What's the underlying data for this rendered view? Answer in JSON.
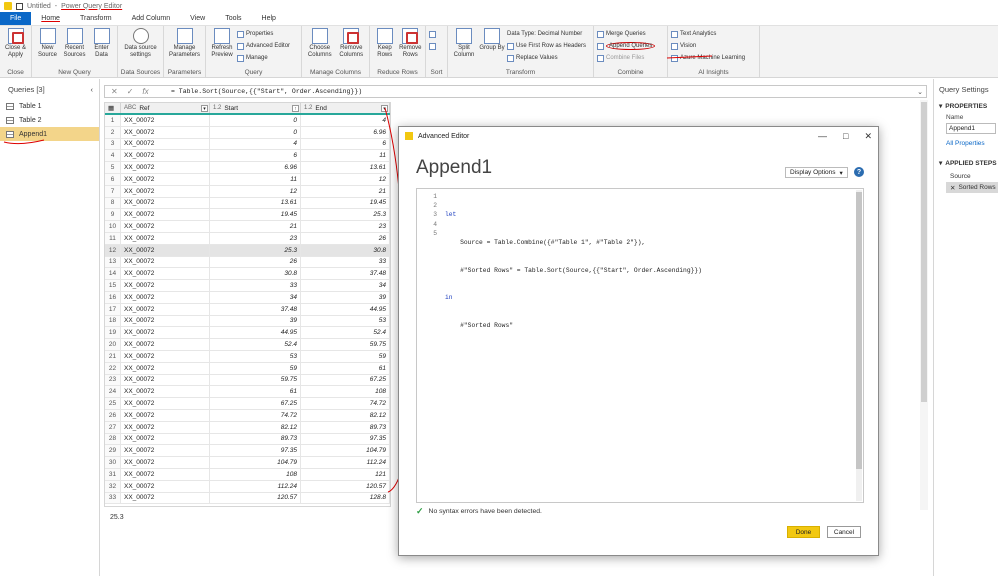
{
  "titlebar": {
    "doc": "Untitled",
    "sep": " - ",
    "app": "Power Query Editor"
  },
  "menu": [
    "File",
    "Home",
    "Transform",
    "Add Column",
    "View",
    "Tools",
    "Help"
  ],
  "ribbon": {
    "close": {
      "btn": "Close & Apply",
      "label": "Close"
    },
    "newq": {
      "btn1": "New Source",
      "btn2": "Recent Sources",
      "btn3": "Enter Data",
      "label": "New Query"
    },
    "ds": {
      "btn": "Data source settings",
      "label": "Data Sources"
    },
    "params": {
      "btn": "Manage Parameters",
      "label": "Parameters"
    },
    "query": {
      "btn": "Refresh Preview",
      "s1": "Properties",
      "s2": "Advanced Editor",
      "s3": "Manage",
      "label": "Query"
    },
    "cols": {
      "btn1": "Choose Columns",
      "btn2": "Remove Columns",
      "label": "Manage Columns"
    },
    "rows": {
      "btn1": "Keep Rows",
      "btn2": "Remove Rows",
      "label": "Reduce Rows"
    },
    "sort": {
      "label": "Sort"
    },
    "transform": {
      "btn1": "Split Column",
      "btn2": "Group By",
      "s1": "Data Type: Decimal Number",
      "s2": "Use First Row as Headers",
      "s3": "Replace Values",
      "label": "Transform"
    },
    "combine": {
      "s1": "Merge Queries",
      "s2": "Append Queries",
      "s3": "Combine Files",
      "label": "Combine"
    },
    "ai": {
      "s1": "Text Analytics",
      "s2": "Vision",
      "s3": "Azure Machine Learning",
      "label": "AI Insights"
    }
  },
  "queries": {
    "header": "Queries [3]",
    "items": [
      "Table 1",
      "Table 2",
      "Append1"
    ]
  },
  "formula": "= Table.Sort(Source,{{\"Start\", Order.Ascending}})",
  "grid": {
    "headers": {
      "ref": "Ref",
      "start": "Start",
      "end": "End",
      "t_ref": "ABC",
      "t_num": "1.2"
    },
    "rows": [
      [
        "1",
        "XX_00072",
        "0",
        "4"
      ],
      [
        "2",
        "XX_00072",
        "0",
        "6.96"
      ],
      [
        "3",
        "XX_00072",
        "4",
        "6"
      ],
      [
        "4",
        "XX_00072",
        "6",
        "11"
      ],
      [
        "5",
        "XX_00072",
        "6.96",
        "13.61"
      ],
      [
        "6",
        "XX_00072",
        "11",
        "12"
      ],
      [
        "7",
        "XX_00072",
        "12",
        "21"
      ],
      [
        "8",
        "XX_00072",
        "13.61",
        "19.45"
      ],
      [
        "9",
        "XX_00072",
        "19.45",
        "25.3"
      ],
      [
        "10",
        "XX_00072",
        "21",
        "23"
      ],
      [
        "11",
        "XX_00072",
        "23",
        "26"
      ],
      [
        "12",
        "XX_00072",
        "25.3",
        "30.8"
      ],
      [
        "13",
        "XX_00072",
        "26",
        "33"
      ],
      [
        "14",
        "XX_00072",
        "30.8",
        "37.48"
      ],
      [
        "15",
        "XX_00072",
        "33",
        "34"
      ],
      [
        "16",
        "XX_00072",
        "34",
        "39"
      ],
      [
        "17",
        "XX_00072",
        "37.48",
        "44.95"
      ],
      [
        "18",
        "XX_00072",
        "39",
        "53"
      ],
      [
        "19",
        "XX_00072",
        "44.95",
        "52.4"
      ],
      [
        "20",
        "XX_00072",
        "52.4",
        "59.75"
      ],
      [
        "21",
        "XX_00072",
        "53",
        "59"
      ],
      [
        "22",
        "XX_00072",
        "59",
        "61"
      ],
      [
        "23",
        "XX_00072",
        "59.75",
        "67.25"
      ],
      [
        "24",
        "XX_00072",
        "61",
        "108"
      ],
      [
        "25",
        "XX_00072",
        "67.25",
        "74.72"
      ],
      [
        "26",
        "XX_00072",
        "74.72",
        "82.12"
      ],
      [
        "27",
        "XX_00072",
        "82.12",
        "89.73"
      ],
      [
        "28",
        "XX_00072",
        "89.73",
        "97.35"
      ],
      [
        "29",
        "XX_00072",
        "97.35",
        "104.79"
      ],
      [
        "30",
        "XX_00072",
        "104.79",
        "112.24"
      ],
      [
        "31",
        "XX_00072",
        "108",
        "121"
      ],
      [
        "32",
        "XX_00072",
        "112.24",
        "120.57"
      ],
      [
        "33",
        "XX_00072",
        "120.57",
        "128.8"
      ]
    ],
    "selected_row": 12
  },
  "status_value": "25.3",
  "settings": {
    "header": "Query Settings",
    "properties": "PROPERTIES",
    "name_label": "Name",
    "name_value": "Append1",
    "all_props": "All Properties",
    "applied": "APPLIED STEPS",
    "steps": [
      "Source",
      "Sorted Rows"
    ]
  },
  "dialog": {
    "window_title": "Advanced Editor",
    "query_name": "Append1",
    "display_options": "Display Options",
    "help": "?",
    "line_numbers": [
      "1",
      "2",
      "3",
      "4",
      "5"
    ],
    "code_lines": [
      "let",
      "    Source = Table.Combine({#\"Table 1\", #\"Table 2\"}),",
      "    #\"Sorted Rows\" = Table.Sort(Source,{{\"Start\", Order.Ascending}})",
      "in",
      "    #\"Sorted Rows\""
    ],
    "status": "No syntax errors have been detected.",
    "done": "Done",
    "cancel": "Cancel"
  },
  "colors": {
    "accent": "#0a67c7",
    "done": "#f2c811",
    "selected_query": "#f3d58a",
    "pen": "#d00000"
  }
}
